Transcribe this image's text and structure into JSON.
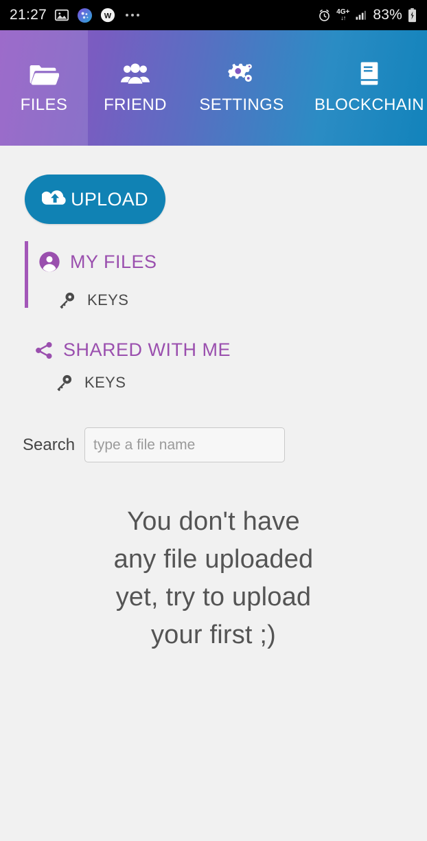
{
  "status_bar": {
    "time": "21:27",
    "battery_percent": "83%",
    "network_type": "4G+",
    "network_arrows": "↓↑",
    "icons": [
      "image-icon",
      "bubbles-app-icon",
      "wonder-app-icon",
      "more-dots-icon",
      "alarm-icon",
      "signal-bars-icon",
      "battery-charging-icon"
    ]
  },
  "nav": {
    "tabs": [
      {
        "label": "FILES",
        "icon": "folder-open-icon",
        "active": true
      },
      {
        "label": "FRIEND",
        "icon": "people-group-icon",
        "active": false
      },
      {
        "label": "SETTINGS",
        "icon": "gears-icon",
        "active": false
      },
      {
        "label": "BLOCKCHAIN",
        "icon": "book-icon",
        "active": false
      }
    ]
  },
  "main": {
    "upload": {
      "label": "UPLOAD",
      "icon": "cloud-upload-icon"
    },
    "my_files": {
      "title": "MY FILES",
      "icon": "user-circle-icon",
      "keys_label": "KEYS",
      "keys_icon": "key-icon"
    },
    "shared_with_me": {
      "title": "SHARED WITH ME",
      "icon": "share-nodes-icon",
      "keys_label": "KEYS",
      "keys_icon": "key-icon"
    },
    "search": {
      "label": "Search",
      "placeholder": "type a file name",
      "value": ""
    },
    "empty_state": "You don't have any file uploaded yet, try to upload your first ;)"
  },
  "colors": {
    "nav_gradient_start": "#8f56c3",
    "nav_gradient_end": "#1283bb",
    "upload_button": "#1082b4",
    "accent_purple": "#9a4fae",
    "page_background": "#f1f1f1",
    "status_bar": "#000000"
  }
}
